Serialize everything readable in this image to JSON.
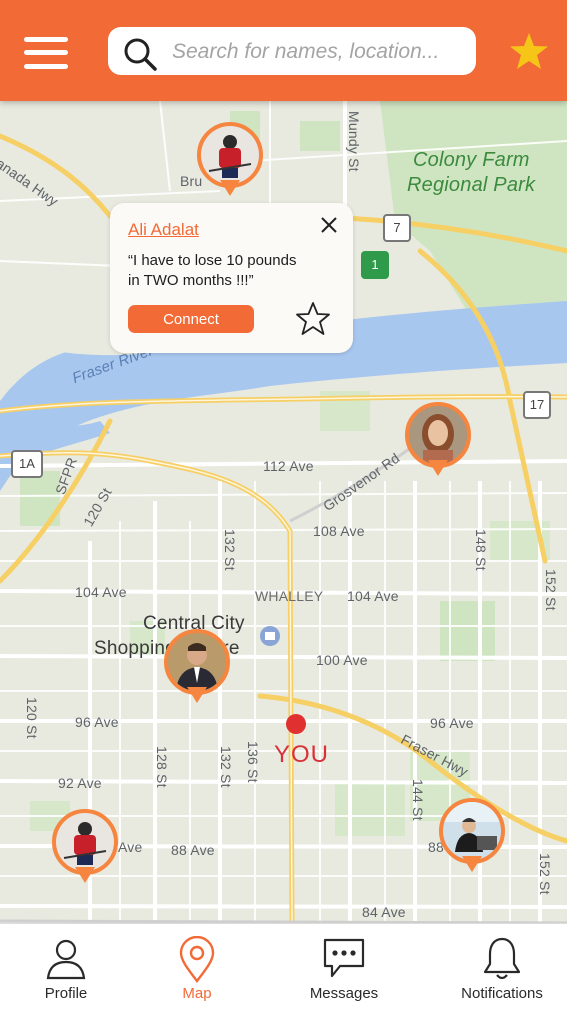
{
  "header": {
    "menu_icon": "hamburger-menu-icon",
    "search_placeholder": "Search for names, location...",
    "search_icon": "search-icon",
    "favorites_icon": "star-icon",
    "accent_color": "#f26b37",
    "star_color": "#f5c518"
  },
  "map": {
    "labels": {
      "canada_hwy": "Canada Hwy",
      "bru": "Bru",
      "mundy_st": "Mundy St",
      "colony_farm_1": "Colony Farm",
      "colony_farm_2": "Regional Park",
      "fraser_river": "Fraser River",
      "ave_112": "112 Ave",
      "grosvenor_rd": "Grosvenor Rd",
      "ave_108": "108 Ave",
      "sfpr": "SFPR",
      "st_120_diag": "120 St",
      "st_132_a": "132 St",
      "st_148": "148 St",
      "st_152_a": "152 St",
      "ave_104_left": "104 Ave",
      "whalley": "WHALLEY",
      "ave_104_right": "104 Ave",
      "central_city_1": "Central City",
      "central_city_2": "Shopping Centre",
      "ave_100": "100 Ave",
      "st_120": "120 St",
      "ave_96_left": "96 Ave",
      "ave_96_right": "96 Ave",
      "st_128": "128 St",
      "st_132_b": "132 St",
      "st_136": "136 St",
      "fraser_hwy": "Fraser Hwy",
      "ave_92": "92 Ave",
      "st_144": "144 St",
      "ave_88_left": "Ave",
      "ave_88_mid": "88 Ave",
      "ave_88_right": "88",
      "st_152_b": "152 St",
      "ave_84": "84 Ave"
    },
    "shields": {
      "hwy7": "7",
      "hwy17": "17",
      "hwy1a": "1A",
      "hwy1": "1"
    },
    "you_label": "YOU",
    "pins": [
      {
        "name": "user-pin-hockey-player-top",
        "avatar": "hockey-player"
      },
      {
        "name": "user-pin-woman",
        "avatar": "woman"
      },
      {
        "name": "user-pin-man-suit",
        "avatar": "man-suit"
      },
      {
        "name": "user-pin-hockey-player-bottom",
        "avatar": "hockey-player"
      },
      {
        "name": "user-pin-office-worker",
        "avatar": "office-worker"
      }
    ]
  },
  "popup": {
    "name": "Ali Adalat",
    "quote": "“I have to lose 10 pounds\n in TWO months !!!”",
    "connect_label": "Connect",
    "close_icon": "close-icon",
    "favorite_icon": "star-outline-icon"
  },
  "nav": {
    "items": [
      {
        "label": "Profile",
        "icon": "person-icon",
        "active": false
      },
      {
        "label": "Map",
        "icon": "map-pin-icon",
        "active": true
      },
      {
        "label": "Messages",
        "icon": "chat-bubble-icon",
        "active": false
      },
      {
        "label": "Notifications",
        "icon": "bell-icon",
        "active": false
      }
    ]
  }
}
